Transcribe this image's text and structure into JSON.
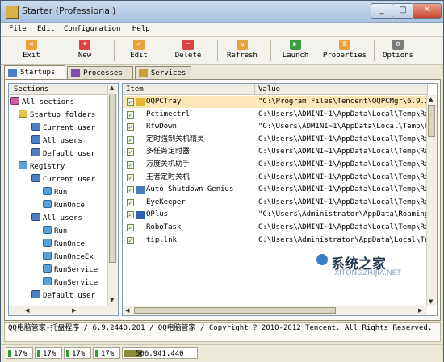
{
  "window": {
    "title": "Starter (Professional)",
    "controls": [
      "_",
      "□",
      "✕"
    ]
  },
  "menu": [
    "File",
    "Edit",
    "Configuration",
    "Help"
  ],
  "toolbar": [
    {
      "label": "Exit",
      "icon": "exit-icon",
      "color": "#e9a23b"
    },
    {
      "label": "New",
      "icon": "new-icon",
      "color": "#d94343"
    },
    {
      "label": "Edit",
      "icon": "edit-icon",
      "color": "#e9a23b"
    },
    {
      "label": "Delete",
      "icon": "delete-icon",
      "color": "#d94343"
    },
    {
      "label": "Refresh",
      "icon": "refresh-icon",
      "color": "#e9a23b"
    },
    {
      "label": "Launch",
      "icon": "launch-icon",
      "color": "#3a9c3a"
    },
    {
      "label": "Properties",
      "icon": "properties-icon",
      "color": "#e9a23b"
    },
    {
      "label": "Options",
      "icon": "options-icon",
      "color": "#7b7b7b"
    }
  ],
  "tabs": [
    {
      "label": "Startups",
      "active": true
    },
    {
      "label": "Processes",
      "active": false
    },
    {
      "label": "Services",
      "active": false
    }
  ],
  "sections": {
    "header": "Sections",
    "items": [
      {
        "label": "All sections",
        "type": "all"
      },
      {
        "label": "Startup folders",
        "type": "folder"
      },
      {
        "label": "Current user",
        "type": "users"
      },
      {
        "label": "All users",
        "type": "users"
      },
      {
        "label": "Default user",
        "type": "users"
      },
      {
        "label": "Registry",
        "type": "reg"
      },
      {
        "label": "Current user",
        "type": "users"
      },
      {
        "label": "Run",
        "type": "reg"
      },
      {
        "label": "RunOnce",
        "type": "reg"
      },
      {
        "label": "All users",
        "type": "users"
      },
      {
        "label": "Run",
        "type": "reg"
      },
      {
        "label": "RunOnce",
        "type": "reg"
      },
      {
        "label": "RunOnceEx",
        "type": "reg"
      },
      {
        "label": "RunService",
        "type": "reg"
      },
      {
        "label": "RunService",
        "type": "reg"
      },
      {
        "label": "Default user",
        "type": "users"
      }
    ]
  },
  "list": {
    "columns": [
      "Item",
      "Value"
    ],
    "rows": [
      {
        "item": "QQPCTray",
        "value": "\"C:\\Program Files\\Tencent\\QQPCMgr\\6.9.24",
        "selected": true,
        "icon_color": "#e6b630"
      },
      {
        "item": "Pctimectrl",
        "value": "C:\\Users\\ADMINI~1\\AppData\\Local\\Temp\\Rar$",
        "selected": false,
        "icon_color": ""
      },
      {
        "item": "RfwDown",
        "value": "\"C:\\Users\\ADMINI~1\\AppData\\Local\\Temp\\Rar$",
        "selected": false,
        "icon_color": ""
      },
      {
        "item": "定时强制关机精灵",
        "value": "C:\\Users\\ADMINI~1\\AppData\\Local\\Temp\\Rar$",
        "selected": false,
        "icon_color": ""
      },
      {
        "item": "多任务定时器",
        "value": "C:\\Users\\ADMINI~1\\AppData\\Local\\Temp\\Rar$",
        "selected": false,
        "icon_color": ""
      },
      {
        "item": "万度关机助手",
        "value": "C:\\Users\\ADMINI~1\\AppData\\Local\\Temp\\Rar$",
        "selected": false,
        "icon_color": ""
      },
      {
        "item": "王者定时关机",
        "value": "C:\\Users\\ADMINI~1\\AppData\\Local\\Temp\\Rar$",
        "selected": false,
        "icon_color": ""
      },
      {
        "item": "Auto Shutdown Genius",
        "value": "C:\\Users\\ADMINI~1\\AppData\\Local\\Temp\\Rar$",
        "selected": false,
        "icon_color": "#4a7db8"
      },
      {
        "item": "EyeKeeper",
        "value": "C:\\Users\\ADMINI~1\\AppData\\Local\\Temp\\Rar$",
        "selected": false,
        "icon_color": ""
      },
      {
        "item": "QPlus",
        "value": "\"C:\\Users\\Administrator\\AppData\\Roaming\\T",
        "selected": false,
        "icon_color": "#2f62b5"
      },
      {
        "item": "RoboTask",
        "value": "C:\\Users\\ADMINI~1\\AppData\\Local\\Temp\\Rar$",
        "selected": false,
        "icon_color": ""
      },
      {
        "item": "tip.lnk",
        "value": "C:\\Users\\Administrator\\AppData\\Local\\Temp",
        "selected": false,
        "icon_color": ""
      }
    ]
  },
  "watermark": {
    "title": "系统之家",
    "url": "XITONGZHIJIA.NET"
  },
  "description": "QQ电脑管家-托盘程序 / 6.9.2440.201 / QQ电脑管家 / Copyright ? 2010-2012 Tencent. All Rights Reserved.",
  "status": {
    "cpu": [
      "17%",
      "17%",
      "17%",
      "17%"
    ],
    "cpu_fill_fraction": [
      0.17,
      0.17,
      0.17,
      0.17
    ],
    "memory": "506,941,440"
  }
}
